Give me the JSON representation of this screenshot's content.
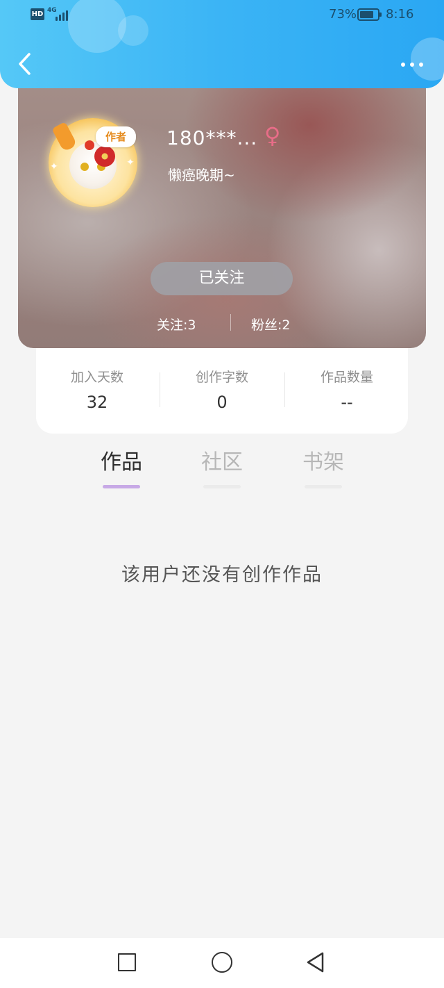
{
  "status_bar": {
    "hd_badge": "HD",
    "network": "4G",
    "battery_percent": "73%",
    "time": "8:16",
    "text_color": "#1b4f6e"
  },
  "header": {
    "back_icon": "chevron-left-icon",
    "more_icon": "more-dots-icon",
    "gradient": [
      "#55c8f7",
      "#2aa7f3"
    ]
  },
  "profile": {
    "author_badge": "作者",
    "username": "180***...",
    "gender_symbol": "♀",
    "signature": "懒癌晚期~",
    "follow_button": "已关注",
    "following": "关注:3",
    "fans": "粉丝:2"
  },
  "stats": [
    {
      "label": "加入天数",
      "value": "32"
    },
    {
      "label": "创作字数",
      "value": "0"
    },
    {
      "label": "作品数量",
      "value": "--"
    }
  ],
  "tabs": [
    {
      "label": "作品",
      "active": true
    },
    {
      "label": "社区",
      "active": false
    },
    {
      "label": "书架",
      "active": false
    }
  ],
  "empty_message": "该用户还没有创作作品",
  "accent_color": "#c7a9e6",
  "nav_bar": {
    "icons": [
      "recent-apps-icon",
      "home-icon",
      "back-triangle-icon"
    ]
  }
}
